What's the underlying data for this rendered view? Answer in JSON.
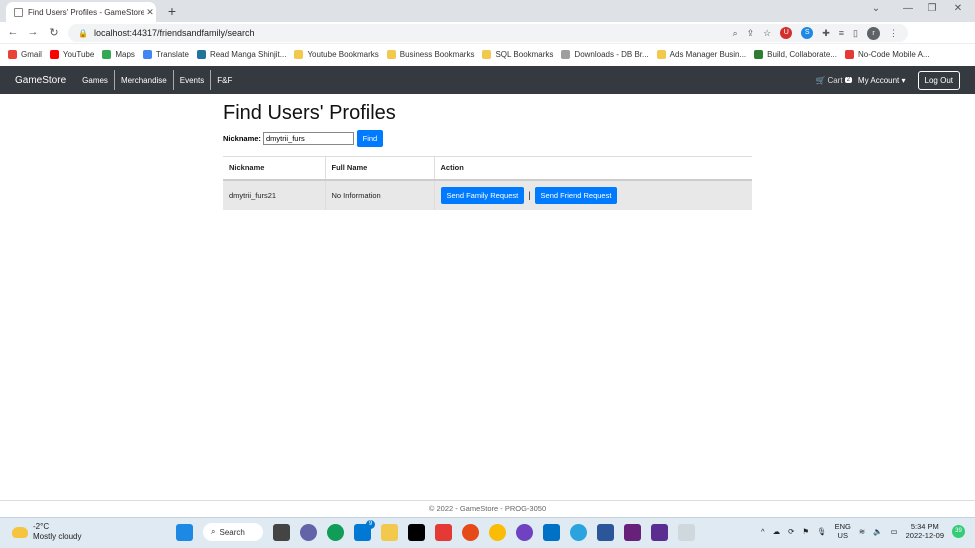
{
  "browser": {
    "tab_title": "Find Users' Profiles - GameStore",
    "url": "localhost:44317/friendsandfamily/search",
    "profile_initial": "r",
    "bookmarks": [
      {
        "label": "Gmail",
        "color": "#ea4335"
      },
      {
        "label": "YouTube",
        "color": "#ff0000"
      },
      {
        "label": "Maps",
        "color": "#34a853"
      },
      {
        "label": "Translate",
        "color": "#4285f4"
      },
      {
        "label": "Read Manga Shinjit...",
        "color": "#21759b"
      },
      {
        "label": "Youtube Bookmarks",
        "color": "#f2c94c"
      },
      {
        "label": "Business Bookmarks",
        "color": "#f2c94c"
      },
      {
        "label": "SQL Bookmarks",
        "color": "#f2c94c"
      },
      {
        "label": "Downloads - DB Br...",
        "color": "#9e9e9e"
      },
      {
        "label": "Ads Manager Busin...",
        "color": "#f2c94c"
      },
      {
        "label": "Build, Collaborate...",
        "color": "#2e7d32"
      },
      {
        "label": "No-Code Mobile A...",
        "color": "#e53935"
      }
    ]
  },
  "site": {
    "brand": "GameStore",
    "nav": [
      "Games",
      "Merchandise",
      "Events",
      "F&F"
    ],
    "cart_label": "Cart",
    "cart_count": "2",
    "account_label": "My Account",
    "logout_label": "Log Out"
  },
  "main": {
    "title": "Find Users' Profiles",
    "nickname_label": "Nickname:",
    "nickname_value": "dmytrii_furs",
    "find_label": "Find",
    "table": {
      "headers": [
        "Nickname",
        "Full Name",
        "Action"
      ],
      "rows": [
        {
          "nickname": "dmytrii_furs21",
          "full_name": "No Information",
          "family_btn": "Send Family Request",
          "separator": "|",
          "friend_btn": "Send Friend Request"
        }
      ]
    }
  },
  "footer": "© 2022 - GameStore - PROG-3050",
  "taskbar": {
    "temperature": "-2°C",
    "weather": "Mostly cloudy",
    "search_label": "Search",
    "language": "ENG",
    "region": "US",
    "time": "5:34 PM",
    "date": "2022-12-09",
    "notifications": "39",
    "mail_badge": "9"
  }
}
